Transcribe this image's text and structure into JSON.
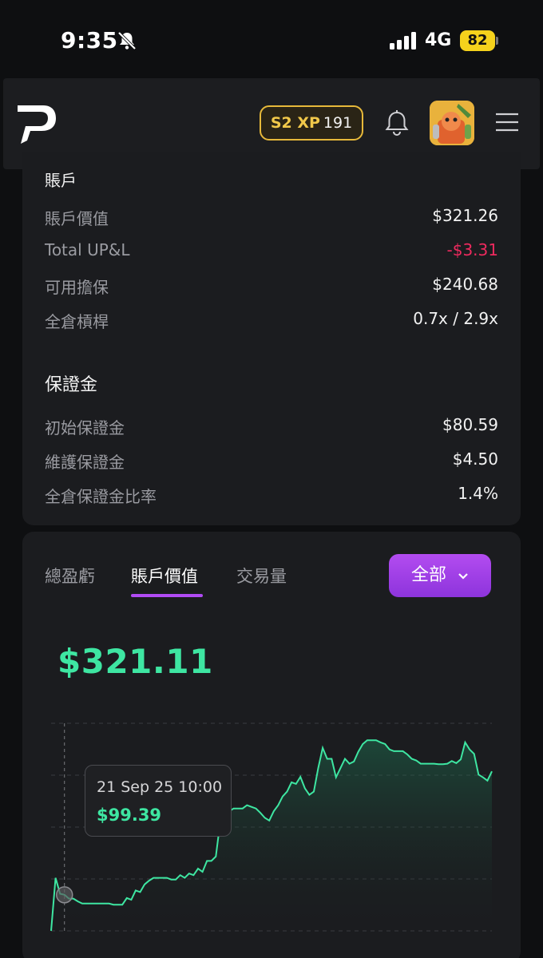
{
  "status_bar": {
    "time": "9:35",
    "network": "4G",
    "battery": "82"
  },
  "header": {
    "xp_season": "S2 XP",
    "xp_value": "191"
  },
  "account": {
    "section_title": "賬戶",
    "rows": [
      {
        "label": "賬戶價值",
        "value": "$321.26"
      },
      {
        "label": "Total UP&L",
        "value": "-$3.31"
      },
      {
        "label": "可用擔保",
        "value": "$240.68"
      },
      {
        "label": "全倉槓桿",
        "value": "0.7x / 2.9x"
      }
    ]
  },
  "margin": {
    "section_title": "保證金",
    "rows": [
      {
        "label": "初始保證金",
        "value": "$80.59"
      },
      {
        "label": "維護保證金",
        "value": "$4.50"
      },
      {
        "label": "全倉保證金比率",
        "value": "1.4%"
      }
    ]
  },
  "chart_panel": {
    "tabs": [
      "總盈虧",
      "賬戶價值",
      "交易量"
    ],
    "active_tab": "賬戶價值",
    "range_button": "全部",
    "current_value": "$321.11",
    "tooltip": {
      "date": "21 Sep 25 10:00",
      "value": "$99.39"
    }
  },
  "colors": {
    "accent_green": "#3ee6a2",
    "accent_purple": "#b14bf4",
    "negative_red": "#ee2a5e",
    "xp_gold": "#e7b93a"
  },
  "chart_data": {
    "type": "area",
    "title": "",
    "xlabel": "",
    "ylabel": "",
    "ylim": [
      40,
      420
    ],
    "grid": true,
    "series": [
      {
        "values": [
          40,
          137,
          108,
          106,
          99,
          99,
          94,
          90,
          90,
          90,
          90,
          90,
          90,
          90,
          88,
          88,
          88,
          100,
          97,
          114,
          111,
          125,
          132,
          137,
          137,
          137,
          137,
          134,
          134,
          142,
          137,
          145,
          142,
          154,
          148,
          168,
          168,
          176,
          241,
          241,
          259,
          264,
          264,
          264,
          270,
          267,
          264,
          256,
          247,
          242,
          259,
          270,
          286,
          295,
          312,
          309,
          322,
          301,
          289,
          295,
          338,
          375,
          355,
          355,
          321,
          338,
          355,
          346,
          350,
          368,
          382,
          389,
          389,
          389,
          385,
          382,
          372,
          369,
          369,
          369,
          363,
          355,
          352,
          346,
          346,
          346,
          346,
          345,
          345,
          346,
          351,
          347,
          354,
          385,
          372,
          364,
          326,
          321,
          315,
          332
        ]
      }
    ]
  }
}
